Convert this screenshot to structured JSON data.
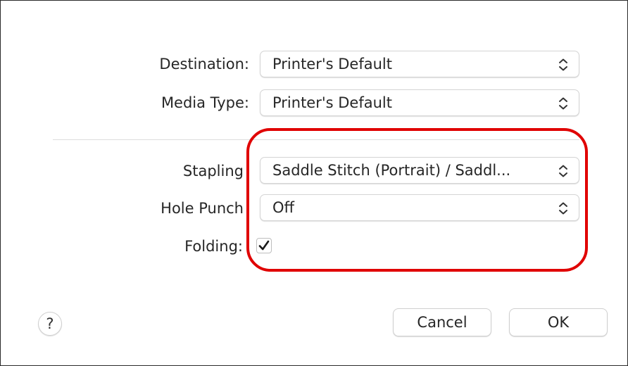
{
  "form": {
    "destination": {
      "label": "Destination:",
      "value": "Printer's Default"
    },
    "media_type": {
      "label": "Media Type:",
      "value": "Printer's Default"
    },
    "stapling": {
      "label": "Stapling",
      "value": "Saddle Stitch (Portrait) / Saddl..."
    },
    "hole_punch": {
      "label": "Hole Punch",
      "value": "Off"
    },
    "folding": {
      "label": "Folding:",
      "checked": true
    }
  },
  "buttons": {
    "help_label": "?",
    "cancel_label": "Cancel",
    "ok_label": "OK"
  },
  "colors": {
    "highlight": "#e00000"
  }
}
